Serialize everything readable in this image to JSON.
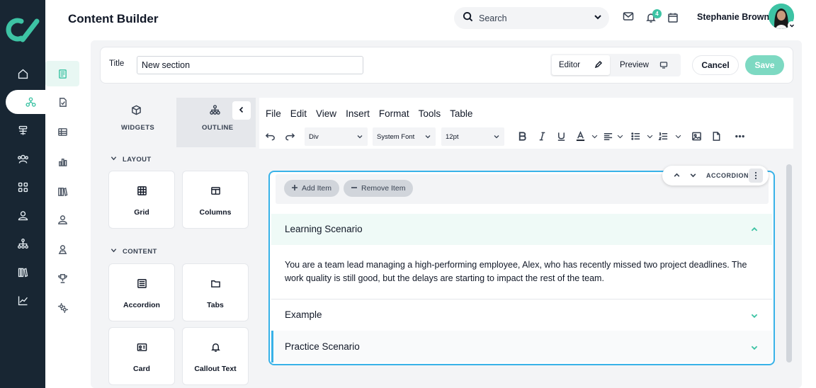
{
  "app": {
    "title": "Content Builder"
  },
  "header": {
    "search_placeholder": "Search",
    "notification_count": "4",
    "user_name": "Stephanie Brown"
  },
  "rail": {
    "items": [
      {
        "icon": "home-icon"
      },
      {
        "icon": "content-builder-icon",
        "active": true
      },
      {
        "icon": "stack-icon"
      },
      {
        "icon": "users-icon"
      },
      {
        "icon": "grid-icon"
      },
      {
        "icon": "user-icon"
      },
      {
        "icon": "hierarchy-icon"
      },
      {
        "icon": "library-icon"
      },
      {
        "icon": "chart-icon"
      }
    ]
  },
  "subrail": {
    "items": [
      {
        "icon": "page-icon",
        "active": true
      },
      {
        "icon": "file-icon"
      },
      {
        "icon": "table-icon"
      },
      {
        "icon": "bar-chart-icon"
      },
      {
        "icon": "books-icon"
      },
      {
        "icon": "person-icon"
      },
      {
        "icon": "person-badge-icon"
      },
      {
        "icon": "trophy-icon"
      },
      {
        "icon": "settings-icon"
      }
    ]
  },
  "form": {
    "title_label": "Title",
    "title_value": "New section",
    "mode_editor": "Editor",
    "mode_preview": "Preview",
    "cancel": "Cancel",
    "save": "Save"
  },
  "widgets": {
    "tab_widgets": "WIDGETS",
    "tab_outline": "OUTLINE",
    "layout_heading": "LAYOUT",
    "content_heading": "CONTENT",
    "layout_tiles": [
      {
        "label": "Grid",
        "icon": "grid-icon"
      },
      {
        "label": "Columns",
        "icon": "columns-icon"
      }
    ],
    "content_tiles": [
      {
        "label": "Accordion",
        "icon": "accordion-icon"
      },
      {
        "label": "Tabs",
        "icon": "folder-icon"
      },
      {
        "label": "Card",
        "icon": "card-icon"
      },
      {
        "label": "Callout Text",
        "icon": "bell-icon"
      }
    ]
  },
  "editor": {
    "menu": [
      "File",
      "Edit",
      "View",
      "Insert",
      "Format",
      "Tools",
      "Table"
    ],
    "block_select": "Div",
    "font_select": "System Font",
    "size_select": "12pt"
  },
  "accordion": {
    "chip_label": "ACCORDION",
    "add_item": "Add Item",
    "remove_item": "Remove Item",
    "items": [
      {
        "title": "Learning Scenario",
        "expanded": true,
        "body": "You are a team lead managing a high-performing employee, Alex, who has recently missed two project deadlines. The work quality is still good, but the delays are starting to impact the rest of the team."
      },
      {
        "title": "Example",
        "expanded": false
      },
      {
        "title": "Practice Scenario",
        "expanded": false
      }
    ]
  },
  "colors": {
    "accent": "#3dc3a4",
    "rail": "#182633",
    "selection": "#38b2e8"
  }
}
